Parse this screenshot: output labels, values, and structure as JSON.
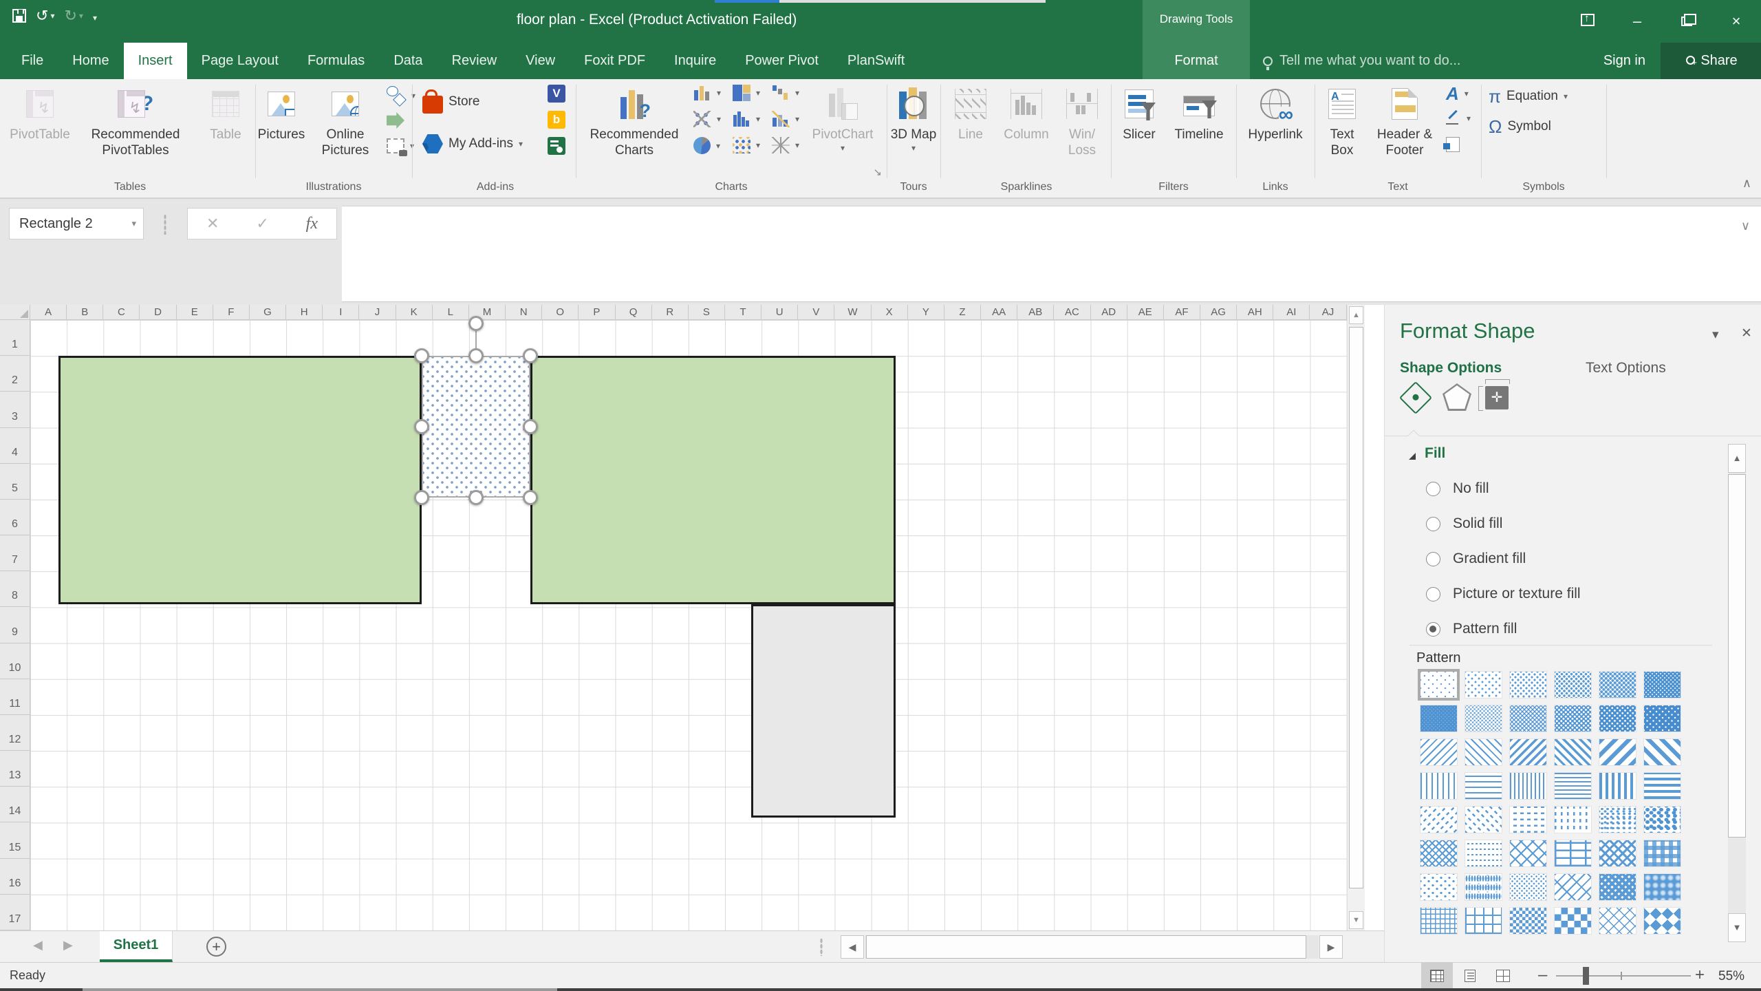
{
  "window": {
    "title": "floor plan - Excel (Product Activation Failed)",
    "contextual_label": "Drawing Tools",
    "tell_me": "Tell me what you want to do...",
    "sign_in": "Sign in",
    "share": "Share"
  },
  "tabs": [
    {
      "label": "File",
      "active": false
    },
    {
      "label": "Home",
      "active": false
    },
    {
      "label": "Insert",
      "active": true
    },
    {
      "label": "Page Layout",
      "active": false
    },
    {
      "label": "Formulas",
      "active": false
    },
    {
      "label": "Data",
      "active": false
    },
    {
      "label": "Review",
      "active": false
    },
    {
      "label": "View",
      "active": false
    },
    {
      "label": "Foxit PDF",
      "active": false
    },
    {
      "label": "Inquire",
      "active": false
    },
    {
      "label": "Power Pivot",
      "active": false
    },
    {
      "label": "PlanSwift",
      "active": false
    }
  ],
  "format_tab": "Format",
  "ribbon": {
    "tables": {
      "label": "Tables",
      "pivottable": "PivotTable",
      "recommended_pivottables": "Recommended PivotTables",
      "table": "Table"
    },
    "illustrations": {
      "label": "Illustrations",
      "pictures": "Pictures",
      "online_pictures": "Online Pictures"
    },
    "addins": {
      "label": "Add-ins",
      "store": "Store",
      "my_addins": "My Add-ins"
    },
    "charts": {
      "label": "Charts",
      "recommended_charts": "Recommended Charts",
      "pivotchart": "PivotChart"
    },
    "tours": {
      "label": "Tours",
      "map": "3D Map"
    },
    "sparklines": {
      "label": "Sparklines",
      "line": "Line",
      "column": "Column",
      "winloss_l1": "Win/",
      "winloss_l2": "Loss"
    },
    "filters": {
      "label": "Filters",
      "slicer": "Slicer",
      "timeline": "Timeline"
    },
    "links": {
      "label": "Links",
      "hyperlink": "Hyperlink"
    },
    "text": {
      "label": "Text",
      "text_box": "Text Box",
      "header_footer": "Header & Footer"
    },
    "symbols": {
      "label": "Symbols",
      "equation": "Equation",
      "symbol": "Symbol",
      "pi": "π",
      "omega": "Ω"
    }
  },
  "formula_bar": {
    "name_box": "Rectangle 2",
    "fx": "fx",
    "cancel": "✕",
    "enter": "✓"
  },
  "grid": {
    "columns": [
      "A",
      "B",
      "C",
      "D",
      "E",
      "F",
      "G",
      "H",
      "I",
      "J",
      "K",
      "L",
      "M",
      "N",
      "O",
      "P",
      "Q",
      "R",
      "S",
      "T",
      "U",
      "V",
      "W",
      "X",
      "Y",
      "Z",
      "AA",
      "AB",
      "AC",
      "AD",
      "AE",
      "AF",
      "AG",
      "AH",
      "AI",
      "AJ"
    ],
    "rows": [
      "1",
      "2",
      "3",
      "4",
      "5",
      "6",
      "7",
      "8",
      "9",
      "10",
      "11",
      "12",
      "13",
      "14",
      "15",
      "16",
      "17"
    ]
  },
  "shapes": {
    "selected_name": "Rectangle 2",
    "green_fill": "#c5dfb3",
    "gray_fill": "#e8e8e8",
    "pattern_blue": "#5b9bd5"
  },
  "panel": {
    "title": "Format Shape",
    "shape_options": "Shape Options",
    "text_options": "Text Options",
    "fill_header": "Fill",
    "pattern_label": "Pattern",
    "fill_options": [
      {
        "label": "No fill",
        "selected": false
      },
      {
        "label": "Solid fill",
        "selected": false
      },
      {
        "label": "Gradient fill",
        "selected": false
      },
      {
        "label": "Picture or texture fill",
        "selected": false
      },
      {
        "label": "Pattern fill",
        "selected": true
      }
    ],
    "patterns": [
      "5%",
      "10%",
      "20%",
      "25%",
      "30%",
      "40%",
      "50%",
      "60%",
      "70%",
      "75%",
      "80%",
      "90%",
      "Light downward diagonal",
      "Light upward diagonal",
      "Dark downward diagonal",
      "Dark upward diagonal",
      "Wide downward diagonal",
      "Wide upward diagonal",
      "Light vertical",
      "Light horizontal",
      "Narrow vertical",
      "Narrow horizontal",
      "Dark vertical",
      "Dark horizontal",
      "Dashed downward diagonal",
      "Dashed upward diagonal",
      "Dashed horizontal",
      "Dashed vertical",
      "Small confetti",
      "Large confetti",
      "Zig zag",
      "Wave",
      "Diagonal brick",
      "Horizontal brick",
      "Weave",
      "Plaid",
      "Divot",
      "Dotted grid",
      "Dotted diamond",
      "Shingle",
      "Trellis",
      "Sphere",
      "Small grid",
      "Large grid",
      "Small checker board",
      "Large checker board",
      "Outlined diamond",
      "Solid diamond"
    ]
  },
  "sheet": {
    "name": "Sheet1"
  },
  "status": {
    "ready": "Ready",
    "zoom": "55%"
  }
}
